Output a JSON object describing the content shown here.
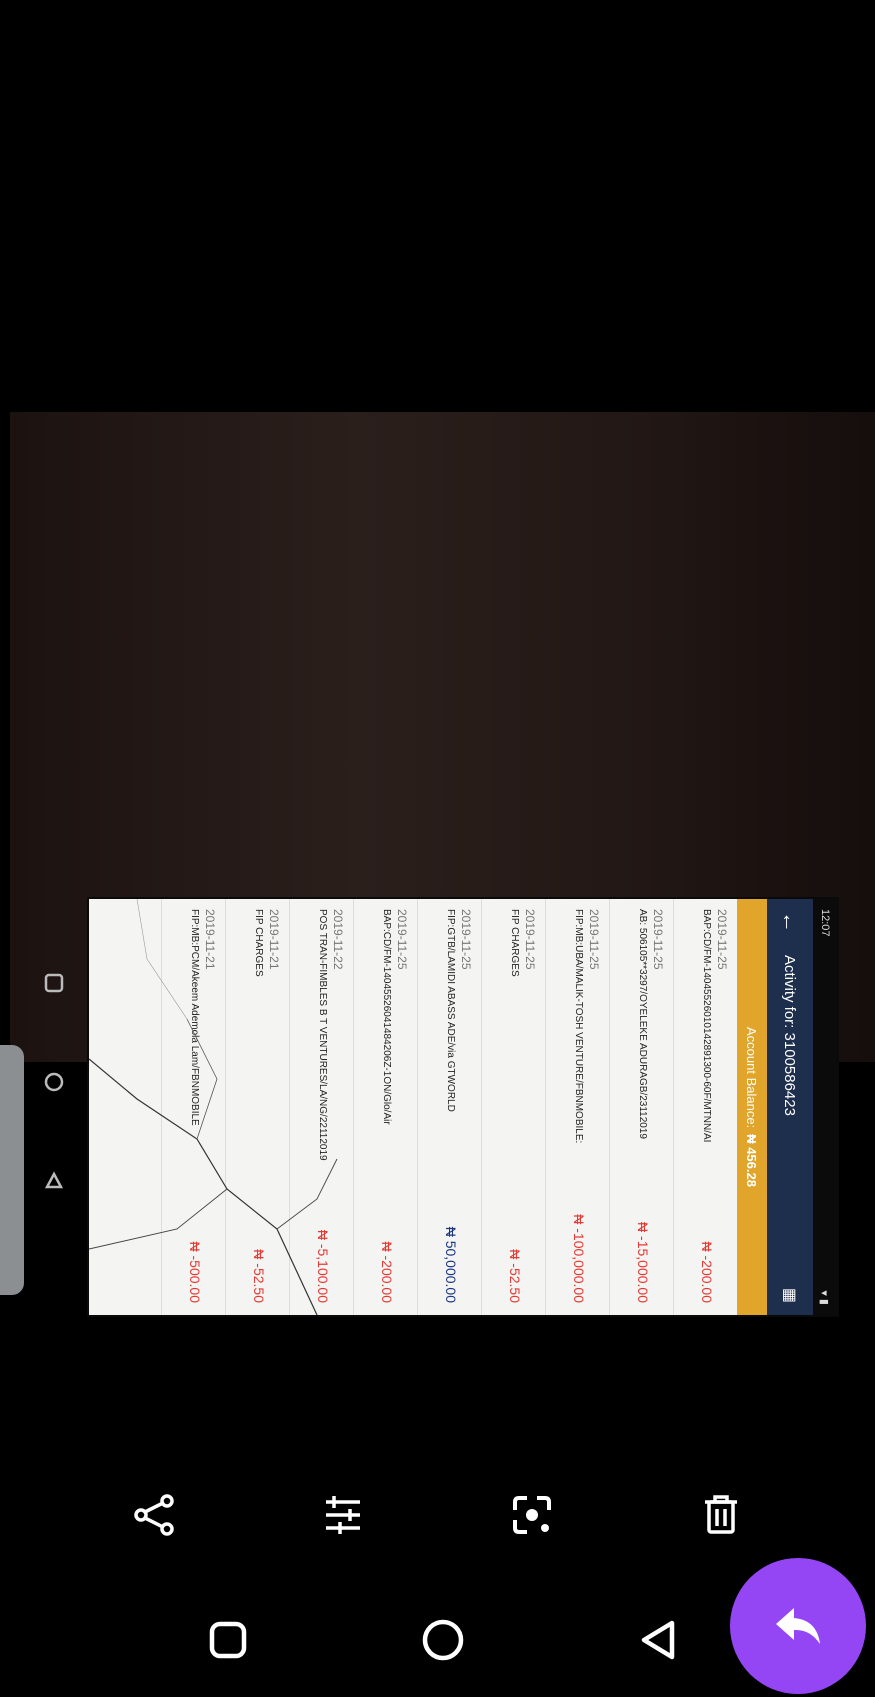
{
  "screen": {
    "time": "12:07",
    "header_title": "Activity for: 3100586423",
    "balance_label": "Account Balance:",
    "balance_value": "₦ 456.28",
    "transactions": [
      {
        "date": "2019-11-25",
        "desc": "BAP:CD/FM-14045526010142891300-60F/MTNN/AI",
        "amount": "₦ -200.00",
        "type": "debit"
      },
      {
        "date": "2019-11-25",
        "desc": "AB: 506105**3297/OYELEKE ADURAGB/23112019",
        "amount": "₦ -15,000.00",
        "type": "debit"
      },
      {
        "date": "2019-11-25",
        "desc": "FIP:MB:UBA/MALIK-TOSH VENTURE/FBNMOBILE:",
        "amount": "₦ -100,000.00",
        "type": "debit"
      },
      {
        "date": "2019-11-25",
        "desc": "FIP CHARGES",
        "amount": "₦ -52.50",
        "type": "debit"
      },
      {
        "date": "2019-11-25",
        "desc": "FIP:GTB/LAMIDI ABASS ADE/via GTWORLD",
        "amount": "₦ 50,000.00",
        "type": "credit"
      },
      {
        "date": "2019-11-25",
        "desc": "BAP:CD/FM-14045526041484206Z-1ON/Glo/Air",
        "amount": "₦ -200.00",
        "type": "debit"
      },
      {
        "date": "2019-11-22",
        "desc": "POS TRAN-FIMBLES B T VENTURES/LA/NG/22112019",
        "amount": "₦ -5,100.00",
        "type": "debit"
      },
      {
        "date": "2019-11-21",
        "desc": "FIP CHARGES",
        "amount": "₦ -52.50",
        "type": "debit"
      },
      {
        "date": "2019-11-21",
        "desc": "FIP:MB:PCM/Akeem Ademola Lam/FBNMOBILE",
        "amount": "₦ -500.00",
        "type": "debit"
      }
    ]
  },
  "toolbar": {
    "icons": [
      "share-icon",
      "adjust-sliders-icon",
      "lens-icon",
      "delete-icon"
    ]
  },
  "colors": {
    "header": "#1d2f4d",
    "balance_bar": "#e0a52a",
    "debit": "#e53935",
    "credit": "#1c3580",
    "fab": "#9546f4"
  }
}
